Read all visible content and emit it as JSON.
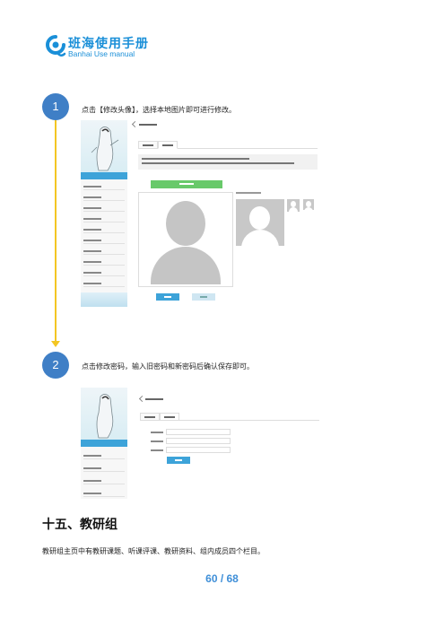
{
  "header": {
    "logo_title": "班海使用手册",
    "logo_subtitle": "Banhai Use manual"
  },
  "steps": [
    {
      "number": "1",
      "text": "点击【修改头像】，选择本地图片即可进行修改。"
    },
    {
      "number": "2",
      "text": "点击修改密码，输入旧密码和新密码后确认保存即可。"
    }
  ],
  "section": {
    "title": "十五、教研组",
    "description": "教研组主页中有教研课题、听课评课、教研资料、组内成员四个栏目。"
  },
  "footer": {
    "page_number": "60 / 68"
  },
  "colors": {
    "brand_blue": "#1a8fd8",
    "step_circle": "#3f7fc6",
    "timeline_yellow": "#f3c623",
    "page_number_blue": "#3f8fd8"
  }
}
